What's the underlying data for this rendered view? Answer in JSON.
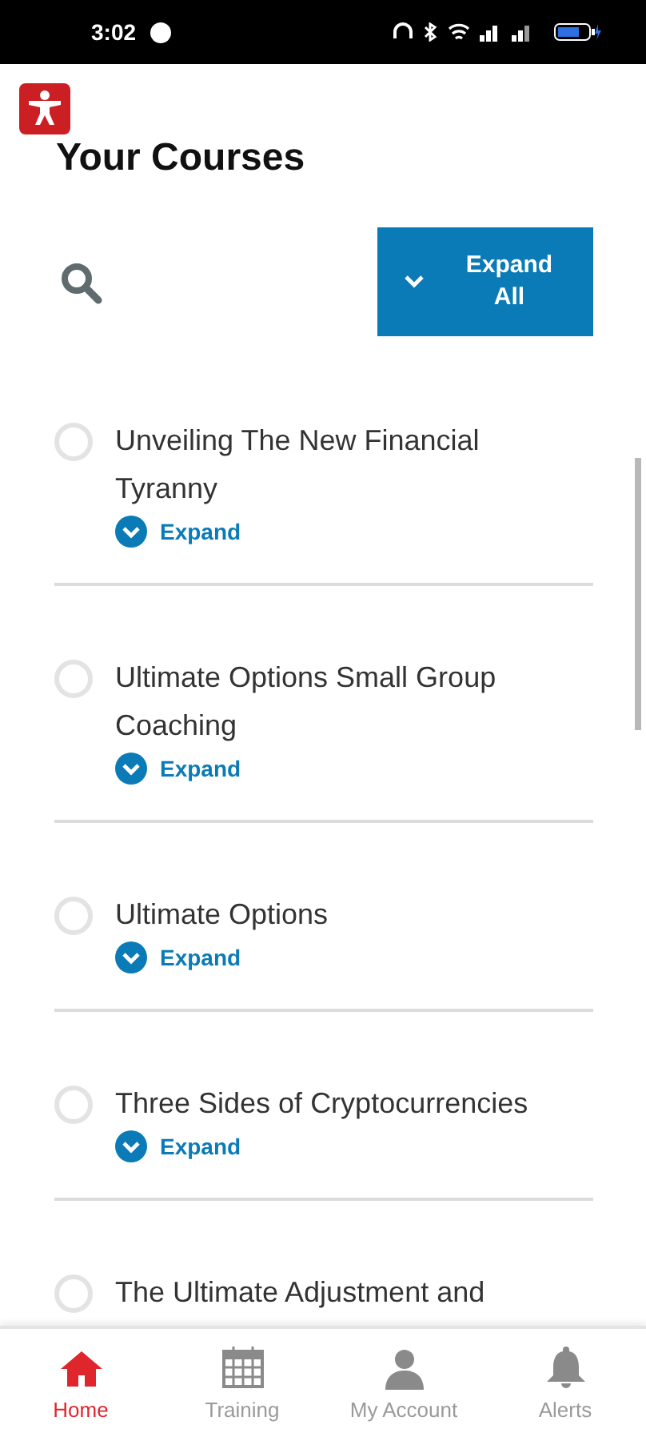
{
  "status_bar": {
    "time": "3:02"
  },
  "header": {
    "title": "Your Courses",
    "expand_all_button": "Expand All"
  },
  "courses": [
    {
      "title": "Unveiling The New Financial Tyranny",
      "completed": false,
      "expand_label": "Expand"
    },
    {
      "title": "Ultimate Options Small Group Coaching",
      "completed": false,
      "expand_label": "Expand"
    },
    {
      "title": "Ultimate Options",
      "completed": false,
      "expand_label": "Expand"
    },
    {
      "title": "Three Sides of Cryptocurrencies",
      "completed": false,
      "expand_label": "Expand"
    },
    {
      "title": "The Ultimate Adjustment and",
      "completed": false
    }
  ],
  "bottom_nav": [
    {
      "kind": "home",
      "label": "Home",
      "selected": true
    },
    {
      "kind": "calendar",
      "label": "Training",
      "selected": false
    },
    {
      "kind": "person",
      "label": "My Account",
      "selected": false
    },
    {
      "kind": "bell",
      "label": "Alerts",
      "selected": false
    }
  ]
}
